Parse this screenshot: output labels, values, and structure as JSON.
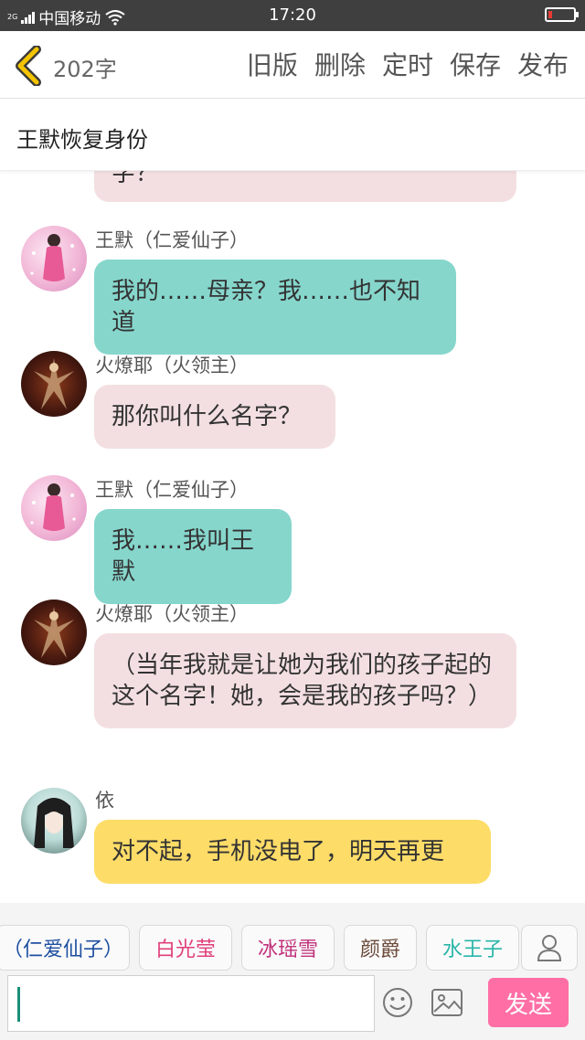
{
  "status_bar": {
    "network": "2G",
    "carrier": "中国移动",
    "time": "17:20"
  },
  "header": {
    "word_count": "202字",
    "actions": [
      "旧版",
      "删除",
      "定时",
      "保存",
      "发布"
    ]
  },
  "story_title": "王默恢复身份",
  "messages": [
    {
      "sender": "",
      "text": "字？",
      "color": "pink",
      "avatar": ""
    },
    {
      "sender": "王默（仁爱仙子）",
      "text": "我的……母亲？我……也不知道",
      "color": "teal",
      "avatar": "pink-fairy-avatar"
    },
    {
      "sender": "火燎耶（火领主）",
      "text": "那你叫什么名字？",
      "color": "pink",
      "avatar": "fire-lord-avatar"
    },
    {
      "sender": "王默（仁爱仙子）",
      "text": "我……我叫王默",
      "color": "teal",
      "avatar": "pink-fairy-avatar"
    },
    {
      "sender": "火燎耶（火领主）",
      "text": "（当年我就是让她为我们的孩子起的这个名字！她，会是我的孩子吗？）",
      "color": "pink",
      "avatar": "fire-lord-avatar"
    },
    {
      "sender": "依",
      "text": "对不起，手机没电了，明天再更",
      "color": "yellow",
      "avatar": "author-avatar"
    }
  ],
  "characters": [
    {
      "name": "（仁爱仙子）",
      "color": "#1e4fa0"
    },
    {
      "name": "白光莹",
      "color": "#e0407a"
    },
    {
      "name": "冰瑶雪",
      "color": "#c0307a"
    },
    {
      "name": "颜爵",
      "color": "#6b4a3a"
    },
    {
      "name": "水王子",
      "color": "#28b5a8"
    }
  ],
  "input": {
    "value": "",
    "send_label": "发送"
  },
  "colors": {
    "teal_bubble": "#86d6cc",
    "pink_bubble": "#f3dfe1",
    "yellow_bubble": "#fddc68",
    "send_button": "#ff6fa6",
    "back_arrow": "#f5c400"
  }
}
